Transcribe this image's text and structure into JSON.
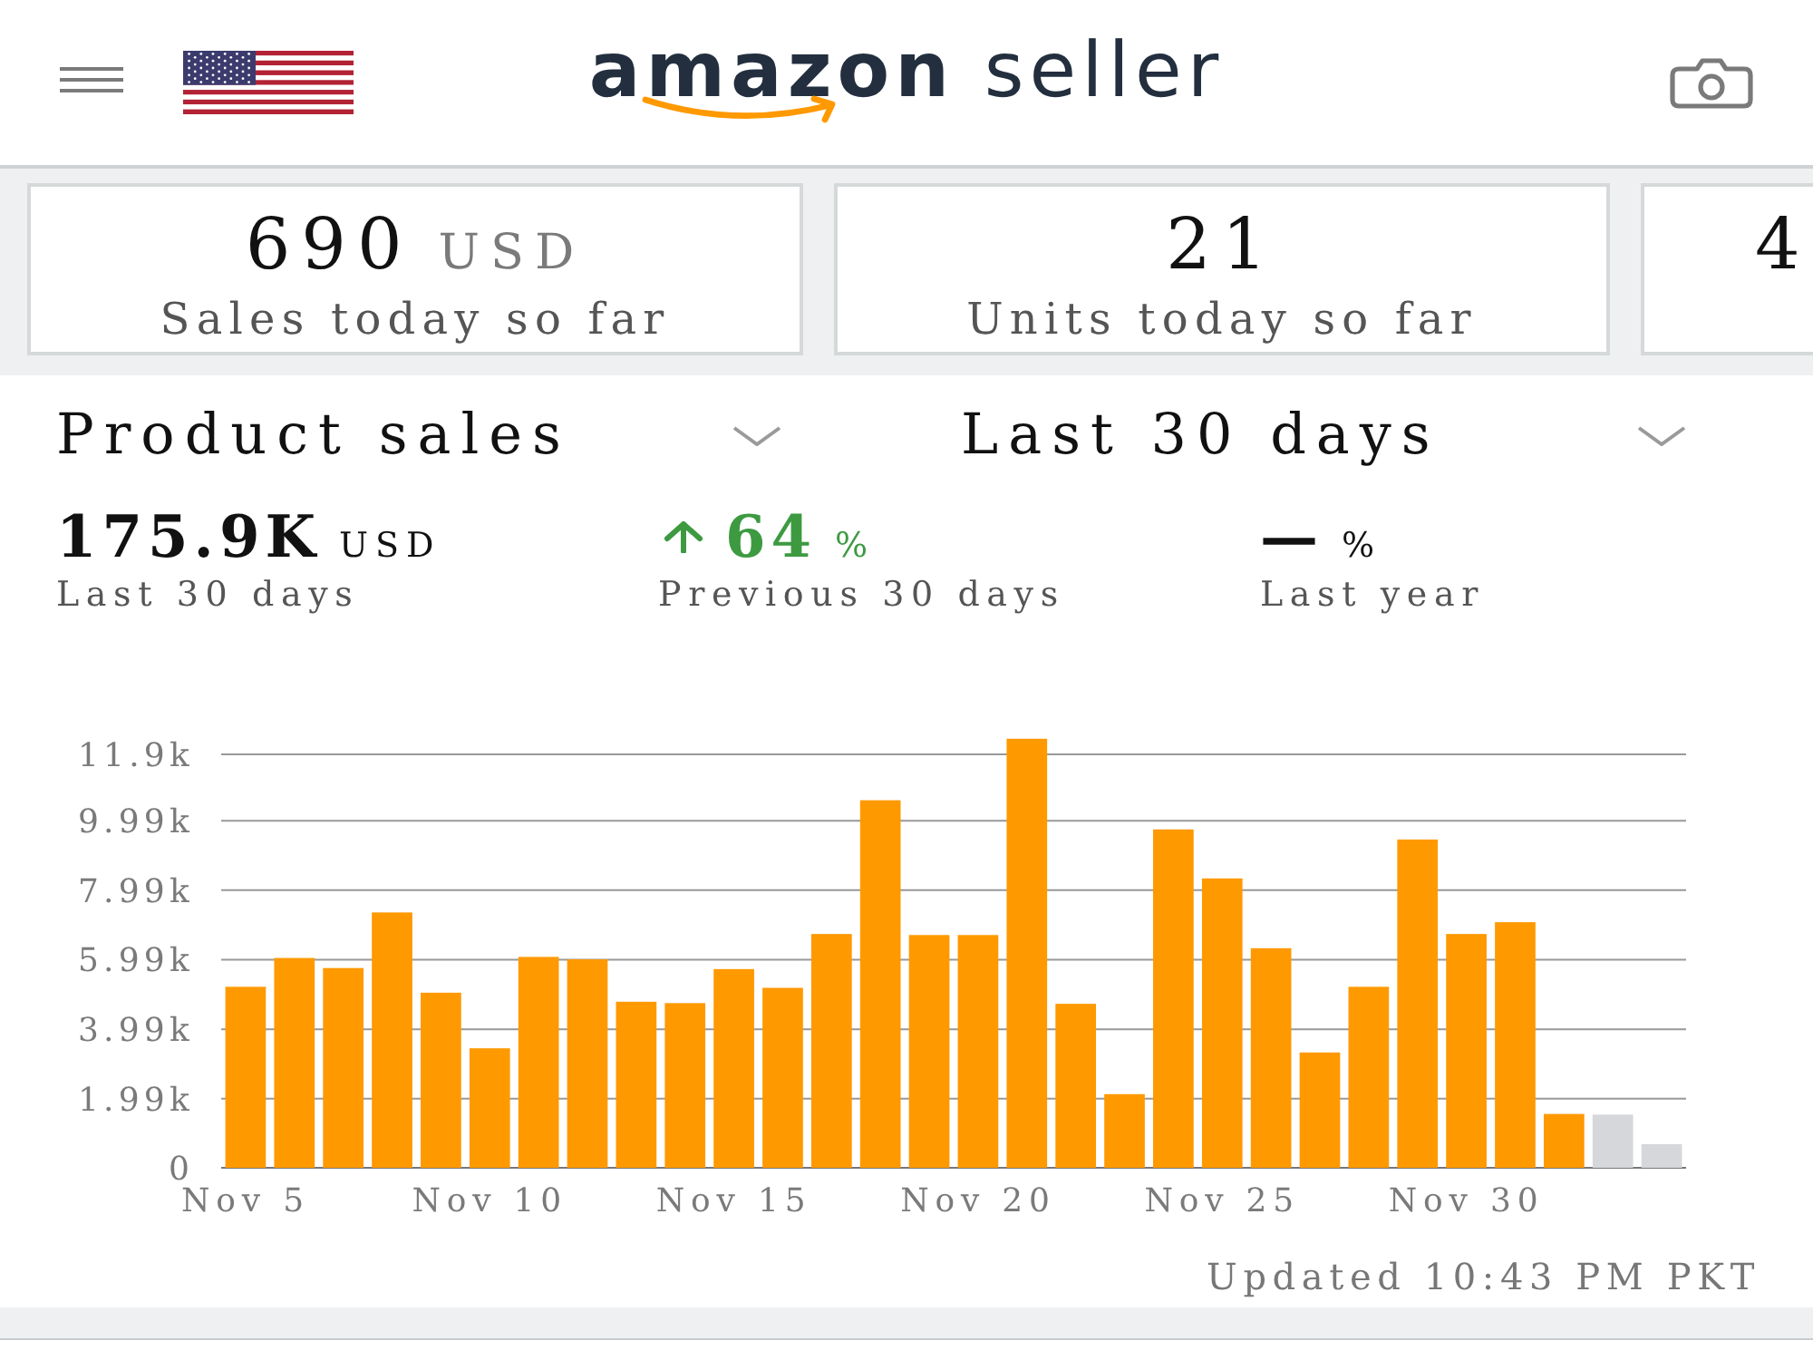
{
  "header": {
    "logo": "**amazon** seller"
  },
  "cards": [
    {
      "kind": "full",
      "value": "690",
      "unit": "USD",
      "label": "Sales today so far"
    },
    {
      "kind": "full",
      "value": "21",
      "label": "Units today so far"
    },
    {
      "kind": "clipped",
      "value": "4"
    }
  ],
  "selectors": [
    {
      "label": "Product sales"
    },
    {
      "label": "Last 30 days"
    }
  ],
  "stats": [
    {
      "value": "175.9K",
      "unit": "USD",
      "caption": "Last 30 days",
      "rising": false
    },
    {
      "value": "64",
      "unit": "%",
      "caption": "Previous 30 days",
      "rising": true
    },
    {
      "value": "—",
      "unit": "%",
      "caption": "Last year",
      "rising": false
    }
  ],
  "chart": {
    "chart_data": {
      "type": "bar",
      "stacked": true,
      "grid": true,
      "categories": [
        "Nov 5",
        null,
        null,
        null,
        null,
        "Nov 10",
        null,
        null,
        null,
        null,
        "Nov 15",
        null,
        null,
        null,
        null,
        "Nov 20",
        null,
        null,
        null,
        null,
        "Nov 25",
        null,
        null,
        null,
        null,
        "Nov 30",
        null,
        null,
        null,
        null
      ],
      "ylim": [
        0,
        12.35
      ],
      "yticks": [
        {
          "value": 0,
          "label": "0"
        },
        {
          "value": 1.99,
          "label": "1.99k"
        },
        {
          "value": 3.99,
          "label": "3.99k"
        },
        {
          "value": 5.99,
          "label": "5.99k"
        },
        {
          "value": 7.99,
          "label": "7.99k"
        },
        {
          "value": 9.99,
          "label": "9.99k"
        },
        {
          "value": 11.9,
          "label": "11.9k"
        }
      ],
      "series": [
        {
          "color": "#ff9900",
          "values": [
            5.21,
            6.04,
            5.75,
            7.35,
            5.04,
            3.44,
            6.07,
            6.0,
            4.78,
            4.74,
            5.72,
            5.18,
            6.73,
            10.58,
            6.7,
            6.7,
            12.35,
            4.72,
            2.12,
            9.74,
            8.33,
            6.32,
            3.32,
            5.21,
            9.45,
            6.73,
            7.07,
            1.55,
            null,
            null
          ]
        },
        {
          "color": "#d5d7da",
          "values": [
            null,
            null,
            null,
            null,
            null,
            null,
            null,
            null,
            null,
            null,
            null,
            null,
            null,
            null,
            null,
            null,
            null,
            null,
            null,
            null,
            null,
            null,
            null,
            null,
            null,
            null,
            null,
            null,
            1.53,
            0.68
          ]
        }
      ]
    }
  },
  "updated": "Updated 10:43 PM PKT"
}
